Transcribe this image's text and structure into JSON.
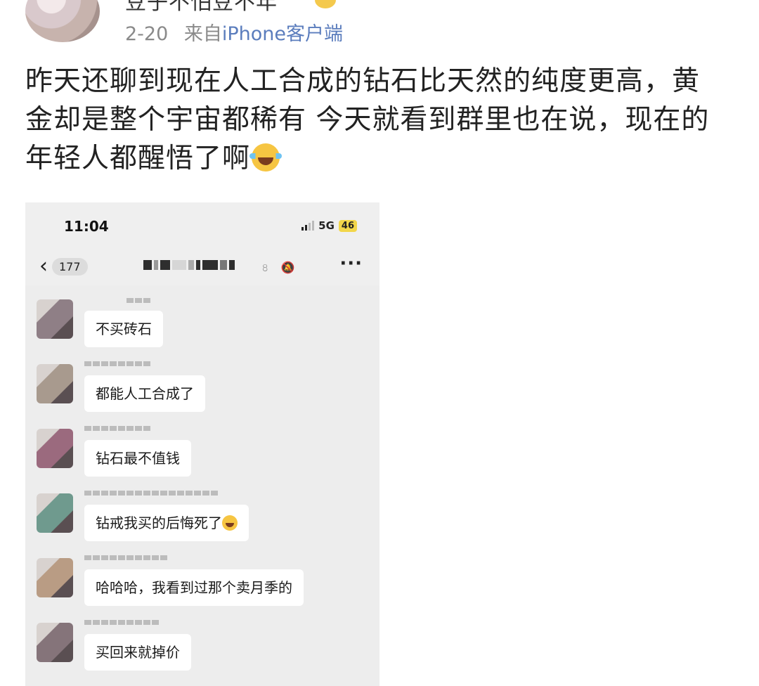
{
  "post": {
    "username": "豆子不怕豆不年",
    "date": "2-20",
    "source_prefix": "来自",
    "source_client": "iPhone客户端",
    "text_line1": "昨天还聊到现在人工合成的钻石比天然的纯度更高，黄",
    "text_line2": "金却是整个宇宙都稀有 今天就看到群里也在说，现在的",
    "text_line3": "年轻人都醒悟了啊",
    "emoji_icon": "laugh-cry-emoji-icon"
  },
  "phone": {
    "status": {
      "time": "11:04",
      "network": "5G",
      "battery": "46"
    },
    "nav": {
      "back_count": "177",
      "more_label": "···",
      "icons": "৪ 🔕"
    },
    "messages": [
      {
        "text": "不买砖石",
        "avatar_color": "#8f7f86"
      },
      {
        "text": "都能人工合成了",
        "avatar_color": "#a89a8e"
      },
      {
        "text": "钻石最不值钱",
        "avatar_color": "#9b6a7e"
      },
      {
        "text": "钻戒我买的后悔死了",
        "avatar_color": "#6f9a8e",
        "emoji_icon": "laugh-cry-emoji-icon"
      },
      {
        "text": "哈哈哈，我看到过那个卖月季的",
        "avatar_color": "#b99c84"
      },
      {
        "text": "买回来就掉价",
        "avatar_color": "#85747a"
      }
    ]
  },
  "colors": {
    "link_blue": "#5b7dbd",
    "meta_gray": "#8a8a8a",
    "chat_bg": "#ededed",
    "bubble_bg": "#ffffff"
  }
}
